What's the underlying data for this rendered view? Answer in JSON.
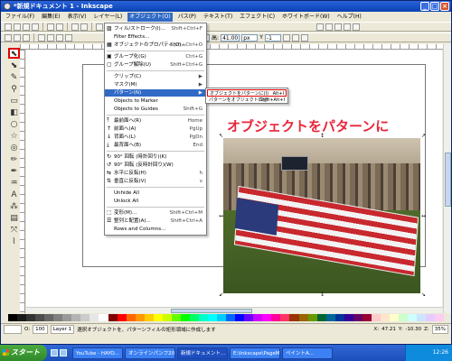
{
  "window": {
    "title": "*新規ドキュメント 1 - Inkscape",
    "buttons": [
      "_",
      "□",
      "×"
    ]
  },
  "menubar": {
    "items": [
      {
        "label": "ファイル(F)",
        "active": false
      },
      {
        "label": "編集(E)",
        "active": false
      },
      {
        "label": "表示(V)",
        "active": false
      },
      {
        "label": "レイヤー(L)",
        "active": false
      },
      {
        "label": "オブジェクト(O)",
        "active": true
      },
      {
        "label": "パス(P)",
        "active": false
      },
      {
        "label": "テキスト(T)",
        "active": false
      },
      {
        "label": "エフェクト(C)",
        "active": false
      },
      {
        "label": "ホワイトボード(W)",
        "active": false
      },
      {
        "label": "ヘルプ(H)",
        "active": false
      }
    ]
  },
  "toolbar2": {
    "w_label": "幅:",
    "w_value": "1",
    "h_label": "高:",
    "h_value": "41.00",
    "unit": "px",
    "lbl_y": "Y",
    "y_value": "-1"
  },
  "object_menu": {
    "items": [
      {
        "icon": "fill-stroke-icon",
        "label": "フィル/ストローク(I)...",
        "shortcut": "Shift+Ctrl+F"
      },
      {
        "icon": "",
        "label": "Filter Effects...",
        "shortcut": ""
      },
      {
        "icon": "object-props-icon",
        "label": "オブジェクトのプロパティ(O)...",
        "shortcut": "Shift+Ctrl+O"
      },
      {
        "icon": "group-icon",
        "label": "グループ化(G)",
        "shortcut": "Ctrl+G"
      },
      {
        "icon": "ungroup-icon",
        "label": "グループ解除(U)",
        "shortcut": "Shift+Ctrl+G"
      },
      {
        "icon": "",
        "label": "クリップ(C)",
        "shortcut": "▶"
      },
      {
        "icon": "",
        "label": "マスク(M)",
        "shortcut": "▶"
      },
      {
        "icon": "",
        "label": "パターン(N)",
        "shortcut": "▶"
      },
      {
        "icon": "",
        "label": "Objects to Marker",
        "shortcut": ""
      },
      {
        "icon": "",
        "label": "Objects to Guides",
        "shortcut": "Shift+G"
      },
      {
        "icon": "raise-top-icon",
        "label": "最前面へ(R)",
        "shortcut": "Home"
      },
      {
        "icon": "raise-icon",
        "label": "前面へ(A)",
        "shortcut": "PgUp"
      },
      {
        "icon": "lower-icon",
        "label": "背面へ(L)",
        "shortcut": "PgDn"
      },
      {
        "icon": "lower-bottom-icon",
        "label": "最背面へ(B)",
        "shortcut": "End"
      },
      {
        "icon": "rotate-cw-icon",
        "label": "90° 回転 (時計回り)(K)",
        "shortcut": ""
      },
      {
        "icon": "rotate-ccw-icon",
        "label": "90° 回転 (反時計回り)(W)",
        "shortcut": ""
      },
      {
        "icon": "flip-h-icon",
        "label": "水平に反転(H)",
        "shortcut": "h"
      },
      {
        "icon": "flip-v-icon",
        "label": "垂直に反転(V)",
        "shortcut": "v"
      },
      {
        "icon": "",
        "label": "Unhide All",
        "shortcut": ""
      },
      {
        "icon": "",
        "label": "Unlock All",
        "shortcut": ""
      },
      {
        "icon": "transform-icon",
        "label": "変形(M)...",
        "shortcut": "Shift+Ctrl+M"
      },
      {
        "icon": "align-icon",
        "label": "整列と配置(A)...",
        "shortcut": "Shift+Ctrl+A"
      },
      {
        "icon": "",
        "label": "Rows and Columns...",
        "shortcut": ""
      }
    ]
  },
  "pattern_submenu": {
    "items": [
      {
        "label": "オブジェクトをパターンに(I)",
        "shortcut": "Alt+I",
        "highlighted": true
      },
      {
        "label": "パターンをオブジェクトに(J)",
        "shortcut": "Shift+Alt+I",
        "highlighted": false
      }
    ]
  },
  "annotation": {
    "text": "オブジェクトをパターンに",
    "color": "#e8263a"
  },
  "statusbar": {
    "opacity_label": "O:",
    "opacity_value": "100",
    "layer_value": "Layer 1",
    "message": "選択オブジェクトを、パターンフィルの矩形領域に作成します",
    "x_label": "X:",
    "x_value": "47.21",
    "y_label": "Y:",
    "y_value": "-10.30",
    "zoom_label": "Z:",
    "zoom_value": "35%"
  },
  "taskbar": {
    "start_label": "スタート",
    "tasks": [
      {
        "label": "YouTube - HAYO...",
        "active": false
      },
      {
        "label": "オンラインパンフ2007...",
        "active": false
      },
      {
        "label": "新規ドキュメント...",
        "active": true
      },
      {
        "label": "E:\\Inkscape\\PageM...",
        "active": false
      },
      {
        "label": "ペイントA...",
        "active": false
      }
    ],
    "clock": "12:26"
  },
  "palette": [
    "#000000",
    "#1a1a1a",
    "#333333",
    "#4d4d4d",
    "#666666",
    "#808080",
    "#999999",
    "#b3b3b3",
    "#cccccc",
    "#e6e6e6",
    "#ffffff",
    "#800000",
    "#ff0000",
    "#ff6600",
    "#ff9900",
    "#ffcc00",
    "#ffff00",
    "#ccff00",
    "#66ff00",
    "#00ff00",
    "#00ff66",
    "#00ffcc",
    "#00ffff",
    "#00ccff",
    "#0066ff",
    "#0000ff",
    "#6600ff",
    "#cc00ff",
    "#ff00ff",
    "#ff0099",
    "#ff3366",
    "#993300",
    "#996600",
    "#669900",
    "#006633",
    "#006699",
    "#003399",
    "#330099",
    "#660066",
    "#990033",
    "#ffcccc",
    "#ffe5cc",
    "#ffffcc",
    "#ccffcc",
    "#ccffff",
    "#cce5ff",
    "#e5ccff",
    "#ffccf2"
  ]
}
